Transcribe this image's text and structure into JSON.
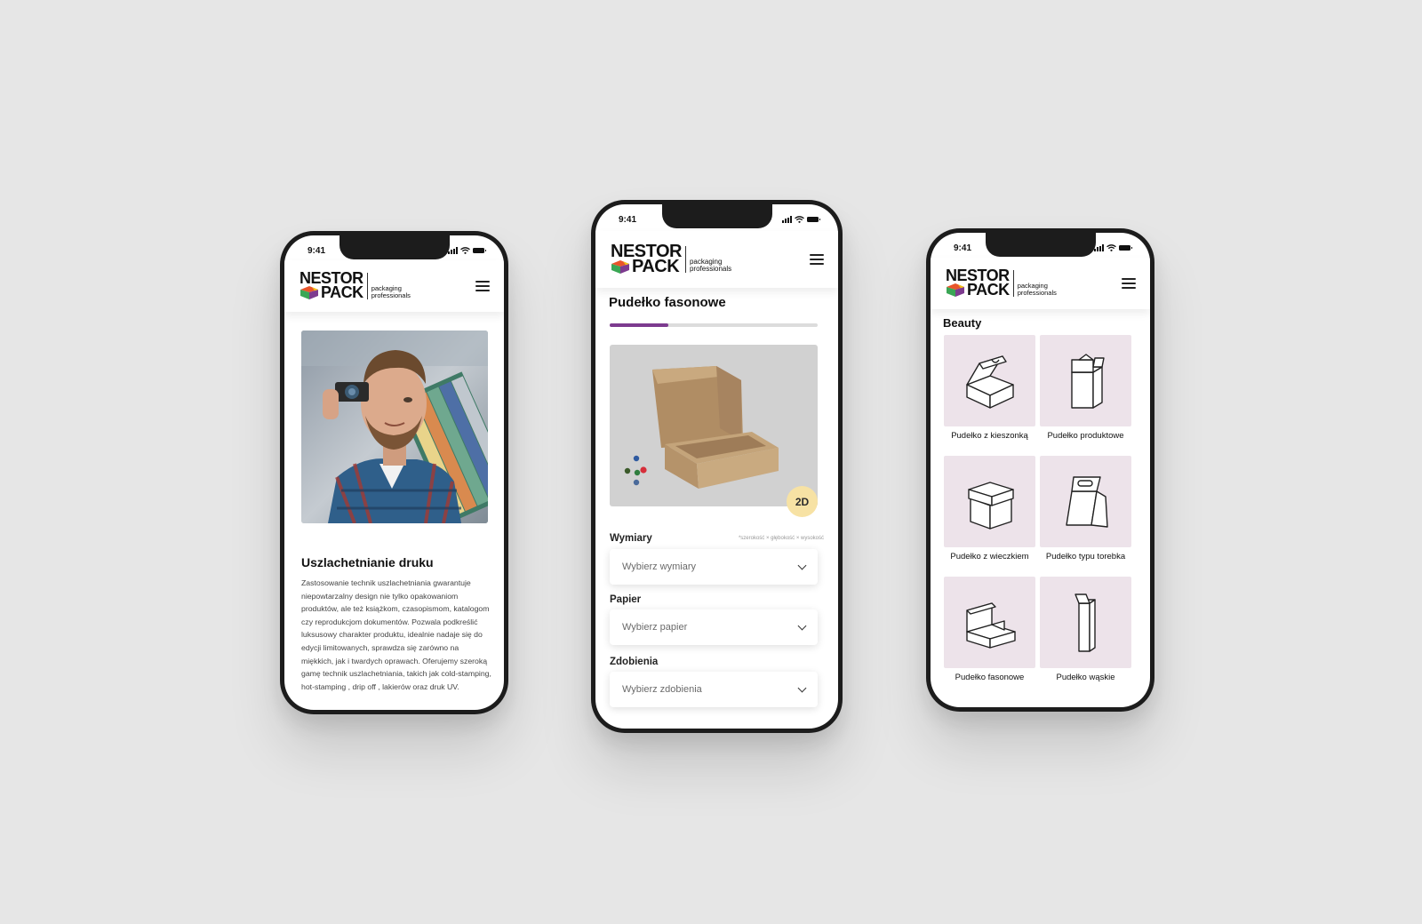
{
  "status_bar": {
    "time": "9:41"
  },
  "brand": {
    "line1": "NESTOR",
    "line2": "PACK",
    "tagline_1": "packaging",
    "tagline_2": "professionals"
  },
  "phone_article": {
    "title": "Uszlachetnianie druku",
    "body": "Zastosowanie technik uszlachetniania gwarantuje niepowtarzalny design nie tylko opakowaniom produktów, ale też książkom, czasopismom, katalogom czy reprodukcjom dokumentów. Pozwala podkreślić luksusowy charakter produktu, idealnie nadaje się do edycji limitowanych, sprawdza się zarówno na miękkich, jak i twardych oprawach. Oferujemy szeroką gamę technik uszlachetniania, takich jak cold-stamping, hot-stamping , drip off , lakierów oraz druk UV."
  },
  "phone_configurator": {
    "title": "Pudełko fasonowe",
    "progress": 0.28,
    "view_toggle": "2D",
    "dimensions_label": "Wymiary",
    "dimensions_hint": "*szerokość × głębokość × wysokość",
    "dimensions_placeholder": "Wybierz wymiary",
    "paper_label": "Papier",
    "paper_placeholder": "Wybierz papier",
    "finish_label": "Zdobienia",
    "finish_placeholder": "Wybierz zdobienia",
    "colors": {
      "accent": "#7d3b8f",
      "badge": "#f7e2a4"
    }
  },
  "phone_catalog": {
    "category": "Beauty",
    "items": [
      {
        "label": "Pudełko z kieszonką",
        "icon": "pocket-box-icon"
      },
      {
        "label": "Pudełko  produktowe",
        "icon": "product-box-icon"
      },
      {
        "label": "Pudełko z wieczkiem",
        "icon": "lid-box-icon"
      },
      {
        "label": "Pudełko typu torebka",
        "icon": "bag-box-icon"
      },
      {
        "label": "Pudełko fasonowe",
        "icon": "mailer-box-icon"
      },
      {
        "label": "Pudełko wąskie",
        "icon": "narrow-box-icon"
      }
    ],
    "tile_color": "#ede3ea"
  }
}
